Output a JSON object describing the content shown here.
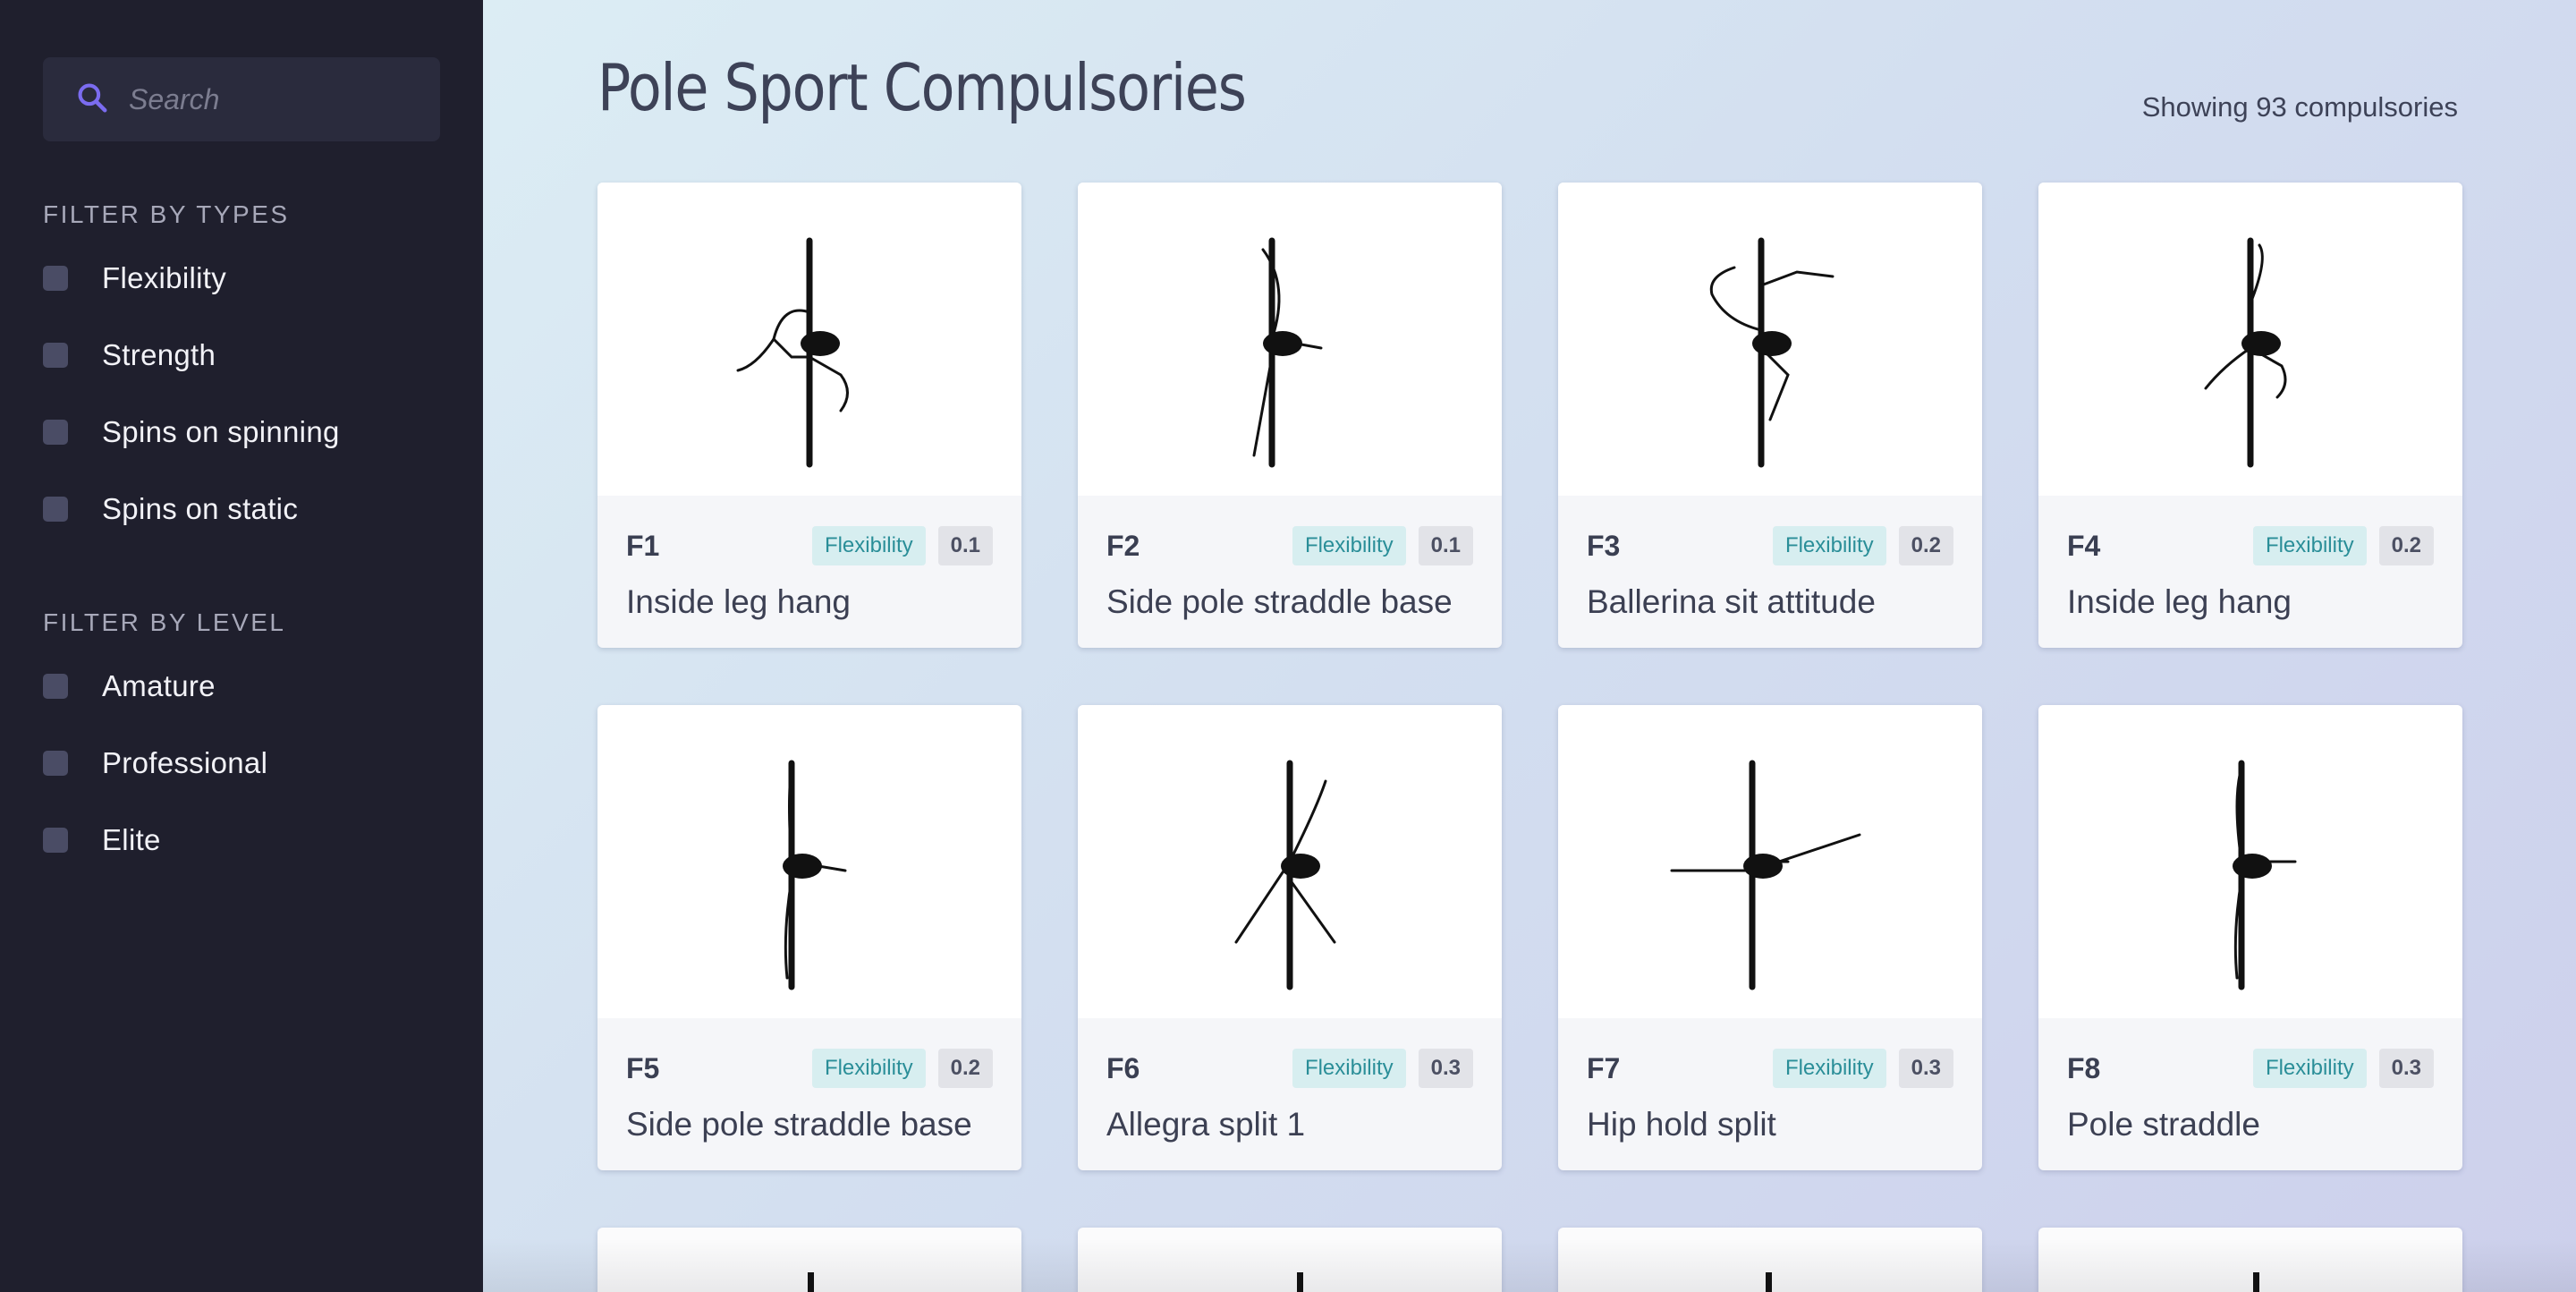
{
  "sidebar": {
    "search_placeholder": "Search",
    "filter_types": {
      "heading": "Filter by types",
      "options": [
        "Flexibility",
        "Strength",
        "Spins on spinning",
        "Spins on static"
      ]
    },
    "filter_level": {
      "heading": "Filter by level",
      "options": [
        "Amature",
        "Professional",
        "Elite"
      ]
    }
  },
  "main": {
    "title": "Pole Sport Compulsories",
    "count_text": "Showing 93 compulsories"
  },
  "cards": [
    {
      "code": "F1",
      "type": "Flexibility",
      "score": "0.1",
      "name": "Inside leg hang"
    },
    {
      "code": "F2",
      "type": "Flexibility",
      "score": "0.1",
      "name": "Side pole straddle base"
    },
    {
      "code": "F3",
      "type": "Flexibility",
      "score": "0.2",
      "name": "Ballerina sit attitude"
    },
    {
      "code": "F4",
      "type": "Flexibility",
      "score": "0.2",
      "name": "Inside leg hang"
    },
    {
      "code": "F5",
      "type": "Flexibility",
      "score": "0.2",
      "name": "Side pole straddle base"
    },
    {
      "code": "F6",
      "type": "Flexibility",
      "score": "0.3",
      "name": "Allegra split 1"
    },
    {
      "code": "F7",
      "type": "Flexibility",
      "score": "0.3",
      "name": "Hip hold split"
    },
    {
      "code": "F8",
      "type": "Flexibility",
      "score": "0.3",
      "name": "Pole straddle"
    }
  ],
  "colors": {
    "sidebar_bg": "#1f1f2d",
    "accent_icon": "#7b6cf0",
    "tag_type_bg": "#d7eef0",
    "tag_type_text": "#2a8e98"
  }
}
